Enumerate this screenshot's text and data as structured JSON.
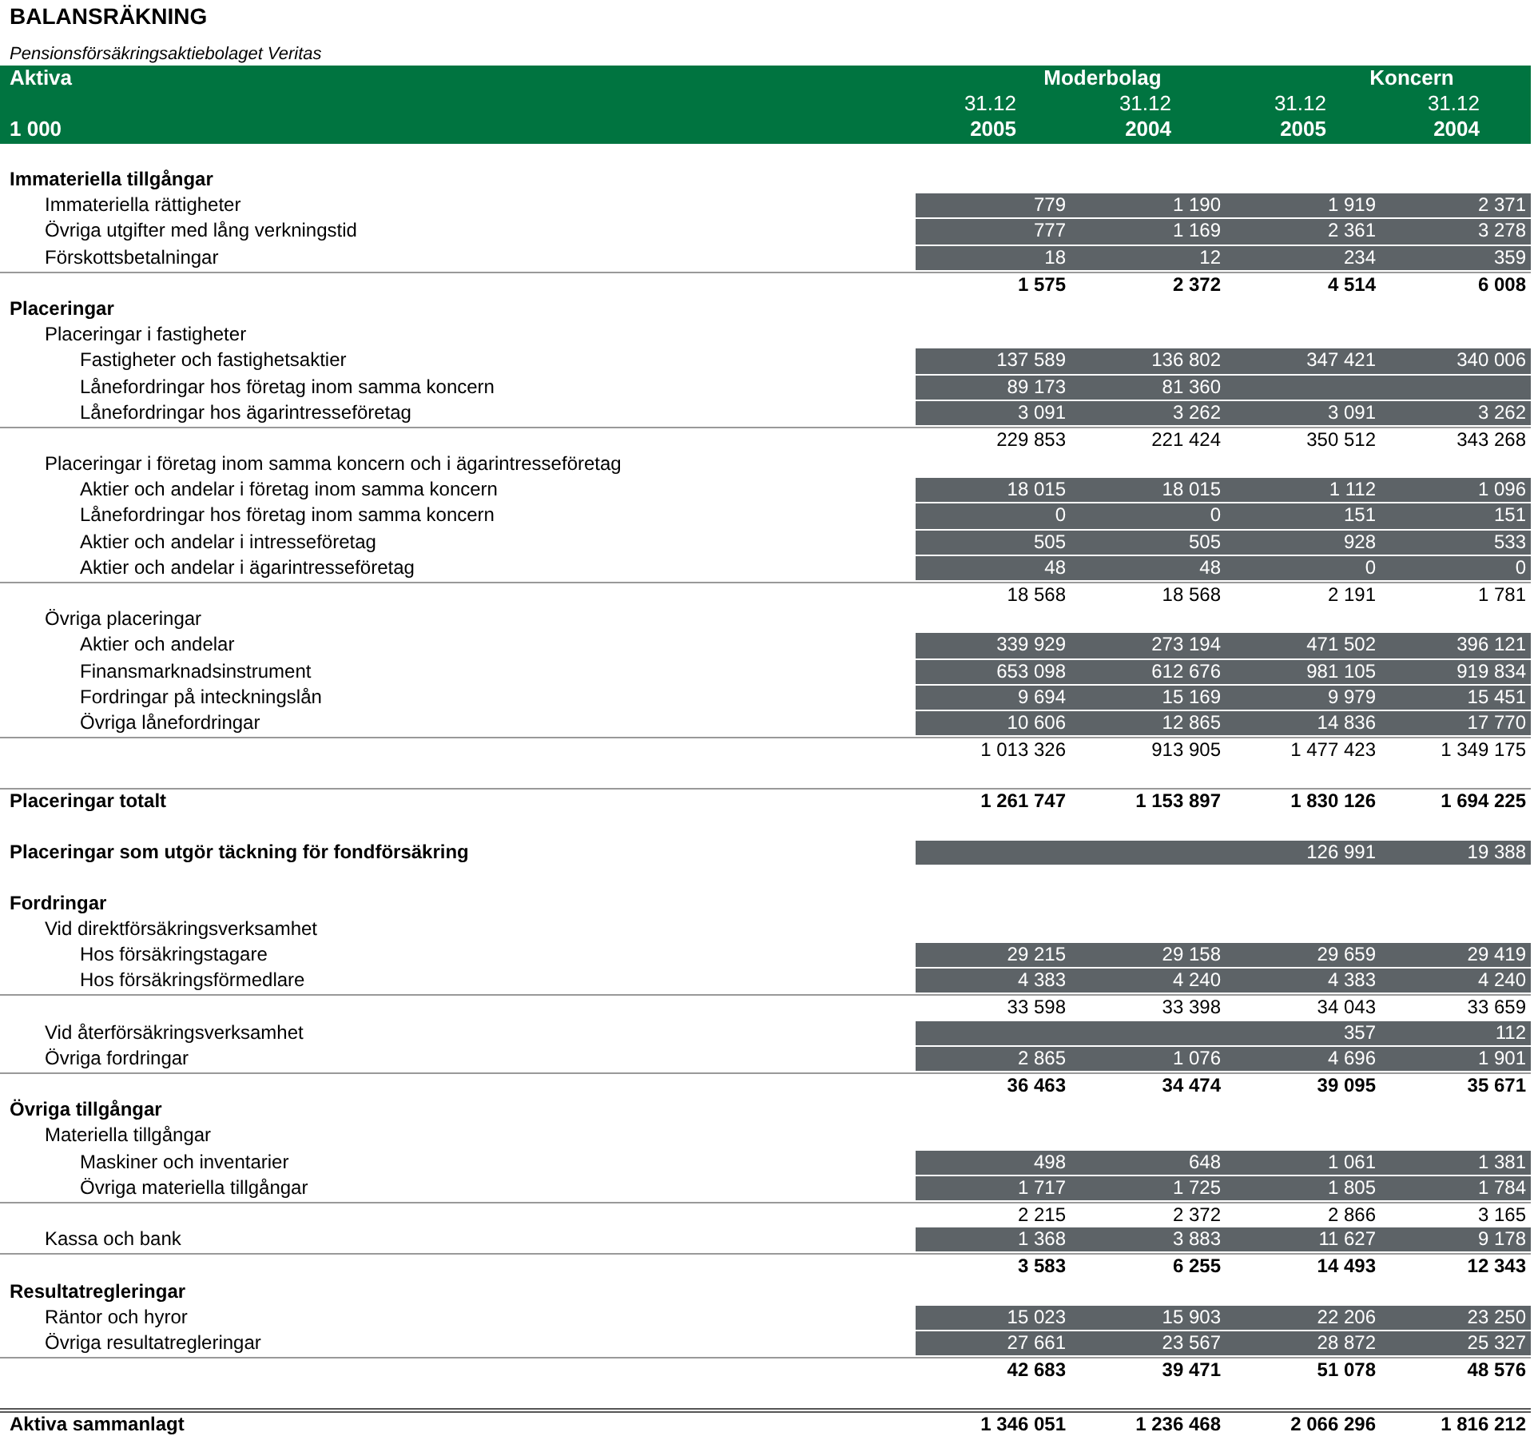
{
  "title": "BALANSRÄKNING",
  "subtitle": "Pensionsförsäkringsaktiebolaget Veritas",
  "header": {
    "title": "Aktiva",
    "unit": "1 000",
    "groups": [
      "Moderbolag",
      "Koncern"
    ],
    "dates": [
      "31.12",
      "31.12",
      "31.12",
      "31.12"
    ],
    "years": [
      "2005",
      "2004",
      "2005",
      "2004"
    ]
  },
  "rows": [
    {
      "kind": "group",
      "label": "Immateriella tillgångar",
      "children": [
        {
          "kind": "item",
          "label": "Immateriella rättigheter",
          "values": {
            "moderbolag_2005": "779",
            "moderbolag_2004": "1 190",
            "koncern_2005": "1 919",
            "koncern_2004": "2 371"
          }
        },
        {
          "kind": "item",
          "label": "Övriga utgifter med lång verkningstid",
          "values": {
            "moderbolag_2005": "777",
            "moderbolag_2004": "1 169",
            "koncern_2005": "2 361",
            "koncern_2004": "3 278"
          }
        },
        {
          "kind": "item",
          "label": "Förskottsbetalningar",
          "values": {
            "moderbolag_2005": "18",
            "moderbolag_2004": "12",
            "koncern_2005": "234",
            "koncern_2004": "359"
          }
        },
        {
          "kind": "total",
          "values": {
            "moderbolag_2005": "1 575",
            "moderbolag_2004": "2 372",
            "koncern_2005": "4 514",
            "koncern_2004": "6 008"
          }
        }
      ]
    },
    {
      "kind": "group",
      "label": "Placeringar",
      "children": [
        {
          "kind": "group",
          "label": "Placeringar i fastigheter",
          "children": [
            {
              "kind": "item",
              "label": "Fastigheter och fastighetsaktier",
              "values": {
                "moderbolag_2005": "137 589",
                "moderbolag_2004": "136 802",
                "koncern_2005": "347 421",
                "koncern_2004": "340 006"
              }
            },
            {
              "kind": "item",
              "label": "Lånefordringar hos företag inom samma koncern",
              "values": {
                "moderbolag_2005": "89 173",
                "moderbolag_2004": "81 360"
              }
            },
            {
              "kind": "item",
              "label": "Lånefordringar hos ägarintresseföretag",
              "values": {
                "moderbolag_2005": "3 091",
                "moderbolag_2004": "3 262",
                "koncern_2005": "3 091",
                "koncern_2004": "3 262"
              }
            },
            {
              "kind": "sum",
              "values": {
                "moderbolag_2005": "229 853",
                "moderbolag_2004": "221 424",
                "koncern_2005": "350 512",
                "koncern_2004": "343 268"
              }
            }
          ]
        },
        {
          "kind": "group",
          "label": "Placeringar i företag inom samma koncern och i ägarintresseföretag",
          "children": [
            {
              "kind": "item",
              "label": "Aktier och andelar i företag inom samma koncern",
              "values": {
                "moderbolag_2005": "18 015",
                "moderbolag_2004": "18 015",
                "koncern_2005": "1 112",
                "koncern_2004": "1 096"
              }
            },
            {
              "kind": "item",
              "label": "Lånefordringar hos företag inom samma koncern",
              "values": {
                "moderbolag_2005": "0",
                "moderbolag_2004": "0",
                "koncern_2005": "151",
                "koncern_2004": "151"
              }
            },
            {
              "kind": "item",
              "label": "Aktier och andelar i intresseföretag",
              "values": {
                "moderbolag_2005": "505",
                "moderbolag_2004": "505",
                "koncern_2005": "928",
                "koncern_2004": "533"
              }
            },
            {
              "kind": "item",
              "label": "Aktier och andelar i ägarintresseföretag",
              "values": {
                "moderbolag_2005": "48",
                "moderbolag_2004": "48",
                "koncern_2005": "0",
                "koncern_2004": "0"
              }
            },
            {
              "kind": "sum",
              "values": {
                "moderbolag_2005": "18 568",
                "moderbolag_2004": "18 568",
                "koncern_2005": "2 191",
                "koncern_2004": "1 781"
              }
            }
          ]
        },
        {
          "kind": "group",
          "label": "Övriga placeringar",
          "children": [
            {
              "kind": "item",
              "label": "Aktier och andelar",
              "values": {
                "moderbolag_2005": "339 929",
                "moderbolag_2004": "273 194",
                "koncern_2005": "471 502",
                "koncern_2004": "396 121"
              }
            },
            {
              "kind": "item",
              "label": "Finansmarknadsinstrument",
              "values": {
                "moderbolag_2005": "653 098",
                "moderbolag_2004": "612 676",
                "koncern_2005": "981 105",
                "koncern_2004": "919 834"
              }
            },
            {
              "kind": "item",
              "label": "Fordringar på inteckningslån",
              "values": {
                "moderbolag_2005": "9 694",
                "moderbolag_2004": "15 169",
                "koncern_2005": "9 979",
                "koncern_2004": "15 451"
              }
            },
            {
              "kind": "item",
              "label": "Övriga lånefordringar",
              "values": {
                "moderbolag_2005": "10 606",
                "moderbolag_2004": "12 865",
                "koncern_2005": "14 836",
                "koncern_2004": "17 770"
              }
            },
            {
              "kind": "sum",
              "values": {
                "moderbolag_2005": "1 013 326",
                "moderbolag_2004": "913 905",
                "koncern_2005": "1 477 423",
                "koncern_2004": "1 349 175"
              }
            }
          ]
        }
      ]
    },
    {
      "kind": "total",
      "label": "Placeringar totalt",
      "values": {
        "moderbolag_2005": "1 261 747",
        "moderbolag_2004": "1 153 897",
        "koncern_2005": "1 830 126",
        "koncern_2004": "1 694 225"
      }
    },
    {
      "kind": "item",
      "label": "Placeringar som utgör täckning för fondförsäkring",
      "values": {
        "koncern_2005": "126 991",
        "koncern_2004": "19 388"
      }
    },
    {
      "kind": "group",
      "label": "Fordringar",
      "children": [
        {
          "kind": "group",
          "label": "Vid direktförsäkringsverksamhet",
          "children": [
            {
              "kind": "item",
              "label": "Hos försäkringstagare",
              "values": {
                "moderbolag_2005": "29 215",
                "moderbolag_2004": "29 158",
                "koncern_2005": "29 659",
                "koncern_2004": "29 419"
              }
            },
            {
              "kind": "item",
              "label": "Hos försäkringsförmedlare",
              "values": {
                "moderbolag_2005": "4 383",
                "moderbolag_2004": "4 240",
                "koncern_2005": "4 383",
                "koncern_2004": "4 240"
              }
            },
            {
              "kind": "sum",
              "values": {
                "moderbolag_2005": "33 598",
                "moderbolag_2004": "33 398",
                "koncern_2005": "34 043",
                "koncern_2004": "33 659"
              }
            }
          ]
        },
        {
          "kind": "item",
          "label": "Vid återförsäkringsverksamhet",
          "values": {
            "koncern_2005": "357",
            "koncern_2004": "112"
          }
        },
        {
          "kind": "item",
          "label": "Övriga fordringar",
          "values": {
            "moderbolag_2005": "2 865",
            "moderbolag_2004": "1 076",
            "koncern_2005": "4 696",
            "koncern_2004": "1 901"
          }
        },
        {
          "kind": "total",
          "values": {
            "moderbolag_2005": "36 463",
            "moderbolag_2004": "34 474",
            "koncern_2005": "39 095",
            "koncern_2004": "35 671"
          }
        }
      ]
    },
    {
      "kind": "group",
      "label": "Övriga tillgångar",
      "children": [
        {
          "kind": "group",
          "label": "Materiella tillgångar",
          "children": [
            {
              "kind": "item",
              "label": "Maskiner och inventarier",
              "values": {
                "moderbolag_2005": "498",
                "moderbolag_2004": "648",
                "koncern_2005": "1 061",
                "koncern_2004": "1 381"
              }
            },
            {
              "kind": "item",
              "label": "Övriga materiella tillgångar",
              "values": {
                "moderbolag_2005": "1 717",
                "moderbolag_2004": "1 725",
                "koncern_2005": "1 805",
                "koncern_2004": "1 784"
              }
            },
            {
              "kind": "sum",
              "values": {
                "moderbolag_2005": "2 215",
                "moderbolag_2004": "2 372",
                "koncern_2005": "2 866",
                "koncern_2004": "3 165"
              }
            }
          ]
        },
        {
          "kind": "item",
          "label": "Kassa och bank",
          "values": {
            "moderbolag_2005": "1 368",
            "moderbolag_2004": "3 883",
            "koncern_2005": "11 627",
            "koncern_2004": "9 178"
          }
        },
        {
          "kind": "total",
          "values": {
            "moderbolag_2005": "3 583",
            "moderbolag_2004": "6 255",
            "koncern_2005": "14 493",
            "koncern_2004": "12 343"
          }
        }
      ]
    },
    {
      "kind": "group",
      "label": "Resultatregleringar",
      "children": [
        {
          "kind": "item",
          "label": "Räntor och hyror",
          "values": {
            "moderbolag_2005": "15 023",
            "moderbolag_2004": "15 903",
            "koncern_2005": "22 206",
            "koncern_2004": "23 250"
          }
        },
        {
          "kind": "item",
          "label": "Övriga resultatregleringar",
          "values": {
            "moderbolag_2005": "27 661",
            "moderbolag_2004": "23 567",
            "koncern_2005": "28 872",
            "koncern_2004": "25 327"
          }
        },
        {
          "kind": "total",
          "values": {
            "moderbolag_2005": "42 683",
            "moderbolag_2004": "39 471",
            "koncern_2005": "51 078",
            "koncern_2004": "48 576"
          }
        }
      ]
    },
    {
      "kind": "grand",
      "label": "Aktiva sammanlagt",
      "values": {
        "moderbolag_2005": "1 346 051",
        "moderbolag_2004": "1 236 468",
        "koncern_2005": "2 066 296",
        "koncern_2004": "1 816 212"
      }
    }
  ]
}
